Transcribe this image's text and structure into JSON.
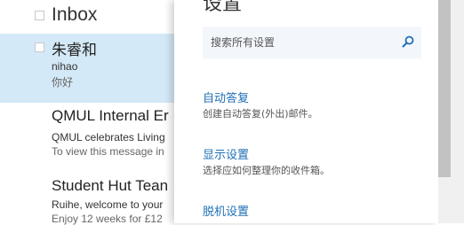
{
  "mail_list": {
    "header_title": "Inbox",
    "items": [
      {
        "sender": "朱睿和",
        "subject": "nihao",
        "preview": "你好",
        "selected": true
      },
      {
        "sender": "QMUL Internal Er",
        "subject": "QMUL celebrates Living",
        "preview": "To view this message in"
      },
      {
        "sender": "Student Hut Tean",
        "subject": "Ruihe, welcome to your",
        "preview": "Enjoy 12 weeks for £12"
      }
    ]
  },
  "settings": {
    "title": "设置",
    "search_placeholder": "搜索所有设置",
    "items": [
      {
        "label": "自动答复",
        "description": "创建自动答复(外出)邮件。"
      },
      {
        "label": "显示设置",
        "description": "选择应如何整理你的收件箱。"
      },
      {
        "label": "脱机设置",
        "description": ""
      }
    ]
  },
  "colors": {
    "accent": "#1f6fb6",
    "selected_row": "#d4e9f7",
    "search_bg": "#f3f7fb"
  }
}
